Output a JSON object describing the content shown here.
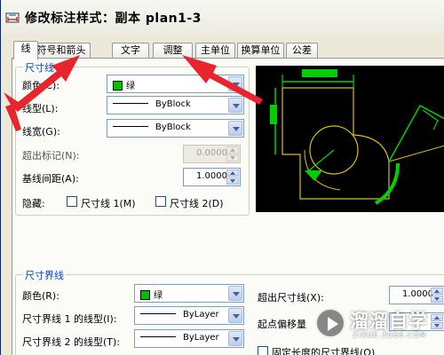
{
  "window": {
    "title": "修改标注样式：副本 plan1-3"
  },
  "tabs": [
    {
      "label": "线"
    },
    {
      "label": "符号和箭头"
    },
    {
      "label": "文字"
    },
    {
      "label": "调整"
    },
    {
      "label": "主单位"
    },
    {
      "label": "换算单位"
    },
    {
      "label": "公差"
    }
  ],
  "dim_lines": {
    "group_title": "尺寸线",
    "color_label": "颜色(C):",
    "color_value": "绿",
    "linetype_label": "线型(L):",
    "linetype_value": "ByBlock",
    "lineweight_label": "线宽(G):",
    "lineweight_value": "ByBlock",
    "extend_label": "超出标记(N):",
    "extend_value": "0.0000",
    "baseline_label": "基线间距(A):",
    "baseline_value": "1.0000",
    "suppress_label": "隐藏:",
    "suppress1_label": "尺寸线 1(M)",
    "suppress2_label": "尺寸线 2(D)"
  },
  "ext_lines": {
    "group_title": "尺寸界线",
    "color_label": "颜色(R):",
    "color_value": "绿",
    "linetype1_label": "尺寸界线 1 的线型(I):",
    "linetype1_value": "ByLayer",
    "linetype2_label": "尺寸界线 2 的线型(T):",
    "linetype2_value": "ByLayer",
    "extend_label": "超出尺寸线(X):",
    "extend_value": "1.0000",
    "offset_label": "起点偏移量",
    "fixed_label": "固定长度的尺寸界线(O)"
  },
  "watermark": {
    "text": "溜溜自学",
    "sub": "ZIXUE.3D66.COM"
  },
  "colors": {
    "annotation_arrow": "#e8242c",
    "dim_green": "#00c000",
    "preview_bg": "#000000",
    "group_title": "#0046d5"
  }
}
